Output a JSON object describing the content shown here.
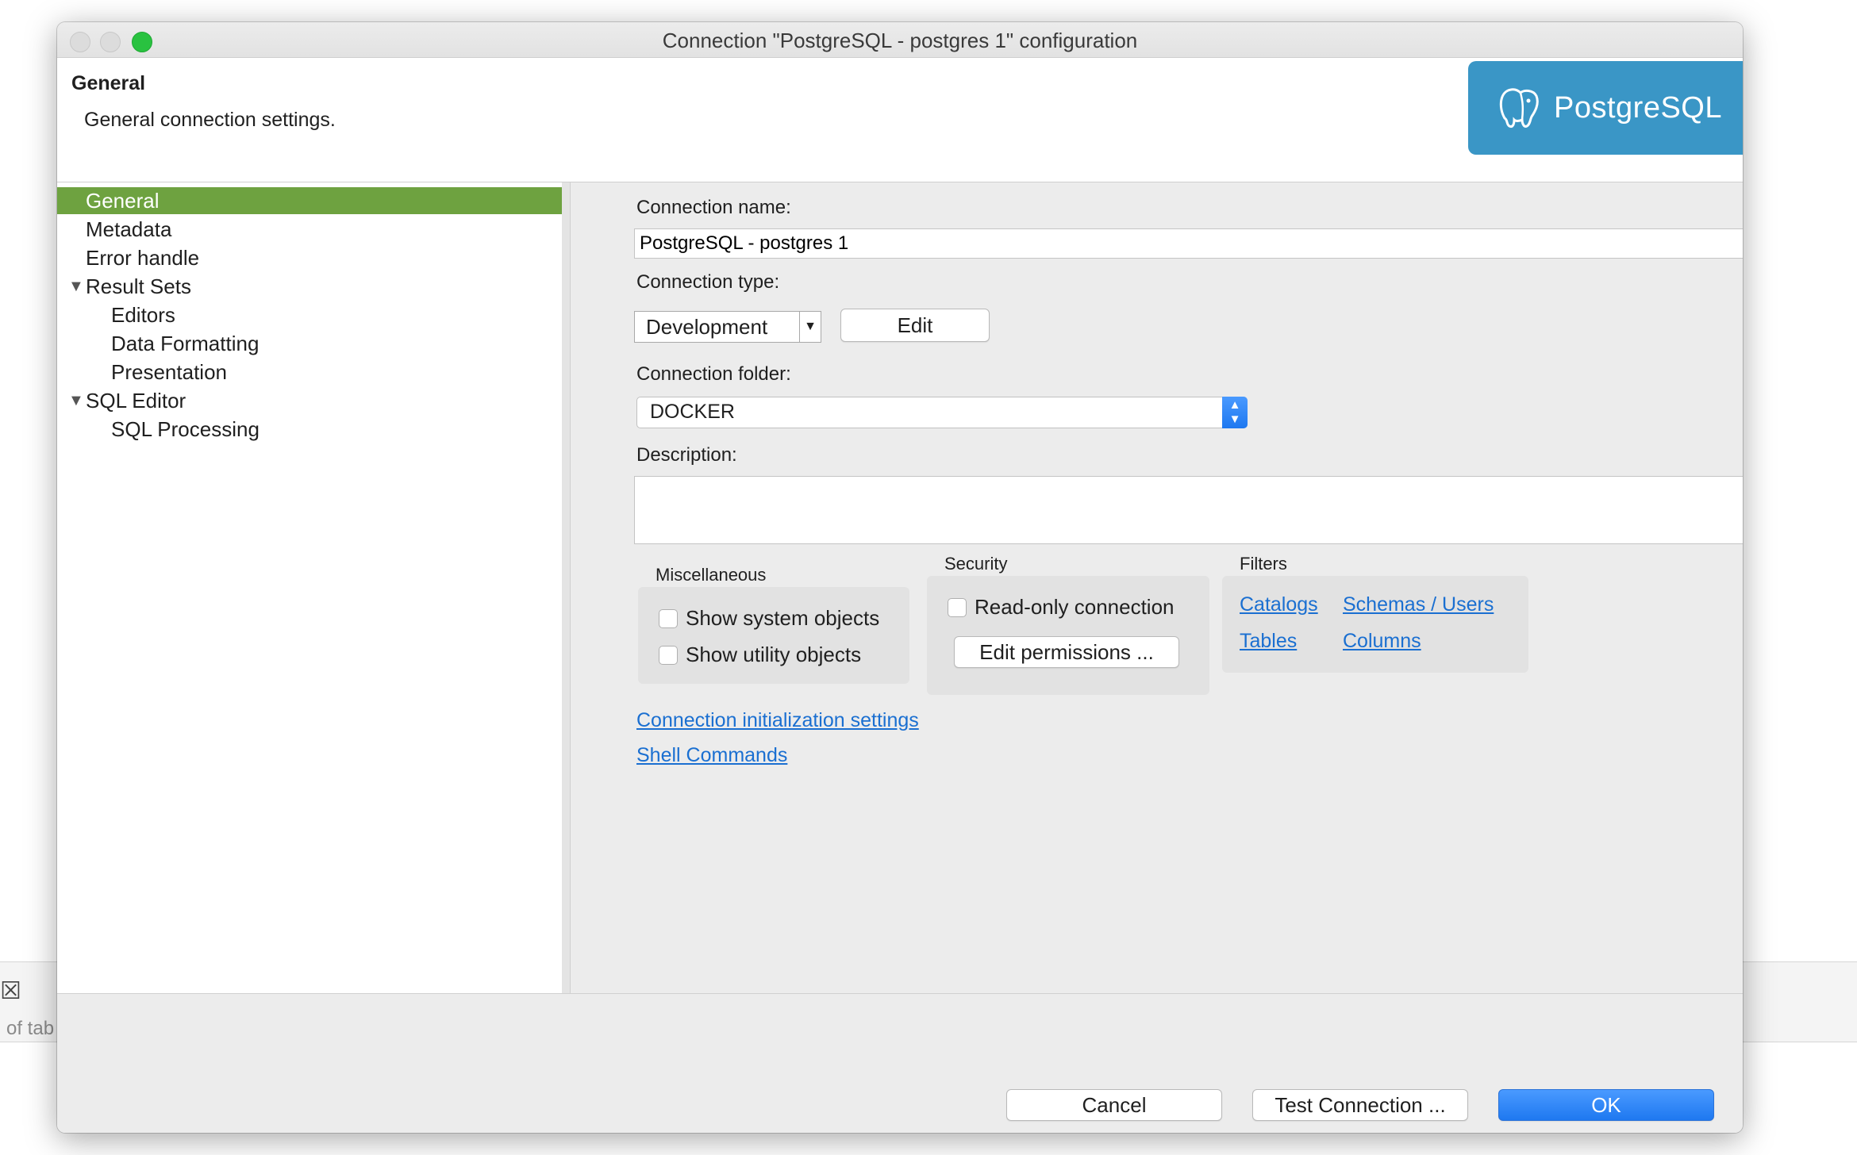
{
  "background_app": {
    "close_glyph": "☒",
    "partial_text": "of tab"
  },
  "window": {
    "title": "Connection \"PostgreSQL - postgres 1\" configuration"
  },
  "header": {
    "title": "General",
    "description": "General connection settings.",
    "logo_text": "PostgreSQL",
    "logo_color": "#3a96c6"
  },
  "tree": {
    "items": [
      {
        "label": "General",
        "selected": true
      },
      {
        "label": "Metadata"
      },
      {
        "label": "Error handle"
      },
      {
        "label": "Result Sets",
        "expanded": true
      },
      {
        "label": "Editors"
      },
      {
        "label": "Data Formatting"
      },
      {
        "label": "Presentation"
      },
      {
        "label": "SQL Editor",
        "expanded": true
      },
      {
        "label": "SQL Processing"
      }
    ],
    "selected_color": "#6ea240"
  },
  "form": {
    "connection_name_label": "Connection name:",
    "connection_name_value": "PostgreSQL - postgres 1",
    "connection_type_label": "Connection type:",
    "connection_type_value": "Development",
    "edit_button": "Edit",
    "connection_folder_label": "Connection folder:",
    "connection_folder_value": "DOCKER",
    "description_label": "Description:",
    "description_value": ""
  },
  "misc": {
    "title": "Miscellaneous",
    "show_system_objects": "Show system objects",
    "show_utility_objects": "Show utility objects"
  },
  "security": {
    "title": "Security",
    "read_only": "Read-only connection",
    "edit_permissions": "Edit permissions ..."
  },
  "filters": {
    "title": "Filters",
    "catalogs": "Catalogs",
    "schemas_users": "Schemas / Users",
    "tables": "Tables",
    "columns": "Columns"
  },
  "links": {
    "init_settings": "Connection initialization settings",
    "shell_commands": "Shell Commands"
  },
  "buttons": {
    "cancel": "Cancel",
    "test_connection": "Test Connection ...",
    "ok": "OK",
    "ok_color": "#1e78f0"
  }
}
